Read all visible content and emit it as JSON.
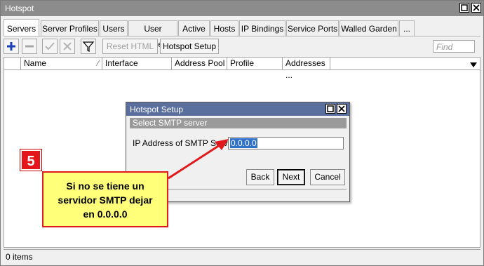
{
  "window": {
    "title": "Hotspot"
  },
  "tabs": [
    {
      "label": "Servers"
    },
    {
      "label": "Server Profiles"
    },
    {
      "label": "Users"
    },
    {
      "label": "User Profiles"
    },
    {
      "label": "Active"
    },
    {
      "label": "Hosts"
    },
    {
      "label": "IP Bindings"
    },
    {
      "label": "Service Ports"
    },
    {
      "label": "Walled Garden"
    },
    {
      "label": "..."
    }
  ],
  "toolbar": {
    "add_icon": "plus-icon",
    "remove_icon": "minus-icon",
    "enable_icon": "check-icon",
    "disable_icon": "x-icon",
    "filter_icon": "filter-icon",
    "reset_html_label": "Reset HTML",
    "hotspot_setup_label": "Hotspot Setup",
    "find_placeholder": "Find"
  },
  "table": {
    "columns": [
      "Name",
      "Interface",
      "Address Pool",
      "Profile",
      "Addresses ..."
    ]
  },
  "status": {
    "items": "0 items"
  },
  "dialog": {
    "title": "Hotspot Setup",
    "section": "Select SMTP server",
    "ip_label": "IP Address of SMTP Server:",
    "ip_value": "0.0.0.0",
    "back_label": "Back",
    "next_label": "Next",
    "cancel_label": "Cancel"
  },
  "annotation": {
    "step": "5",
    "note_lines": [
      "Si no se tiene un",
      "servidor SMTP dejar",
      "en 0.0.0.0"
    ],
    "accent": "#e0191c",
    "note_bg": "#ffff7a"
  }
}
